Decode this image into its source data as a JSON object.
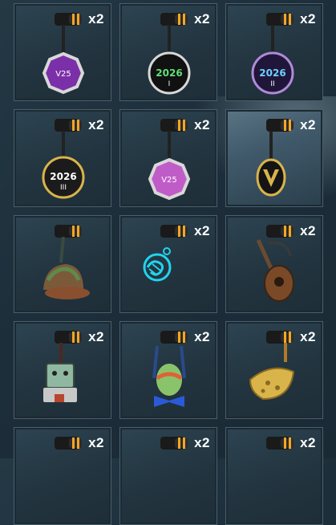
{
  "inventory": {
    "items": [
      {
        "name": "vct-octagon-purple-charm",
        "qty": "x2"
      },
      {
        "name": "2026-round-charm-i",
        "qty": "x2",
        "charm_text": "2026",
        "charm_sub": "I"
      },
      {
        "name": "2026-round-charm-ii",
        "qty": "x2",
        "charm_text": "2026",
        "charm_sub": "II"
      },
      {
        "name": "2026-round-charm-iii",
        "qty": "x2",
        "charm_text": "2026",
        "charm_sub": "III"
      },
      {
        "name": "vct-octagon-pink-charm",
        "qty": "x2"
      },
      {
        "name": "valorant-v-gold-charm",
        "qty": "x2"
      },
      {
        "name": "camo-cap-charm",
        "qty": "x2"
      },
      {
        "name": "neon-spiral-charm",
        "qty": "x2"
      },
      {
        "name": "lute-guitar-charm",
        "qty": "x2"
      },
      {
        "name": "robot-espresso-charm",
        "qty": "x2"
      },
      {
        "name": "egg-bowtie-charm",
        "qty": "x2"
      },
      {
        "name": "cheese-wedge-charm",
        "qty": "x2"
      },
      {
        "name": "partial-charm-1",
        "qty": "x2"
      },
      {
        "name": "partial-charm-2",
        "qty": "x2"
      },
      {
        "name": "partial-charm-3",
        "qty": "x2"
      }
    ]
  },
  "colors": {
    "accent_orange": "#f5a623",
    "purple": "#7b2fa8",
    "pink": "#c05cc8",
    "neon": "#22d3ee",
    "gold": "#d9b44a"
  },
  "icons": [
    "ammo-cap-icon"
  ]
}
